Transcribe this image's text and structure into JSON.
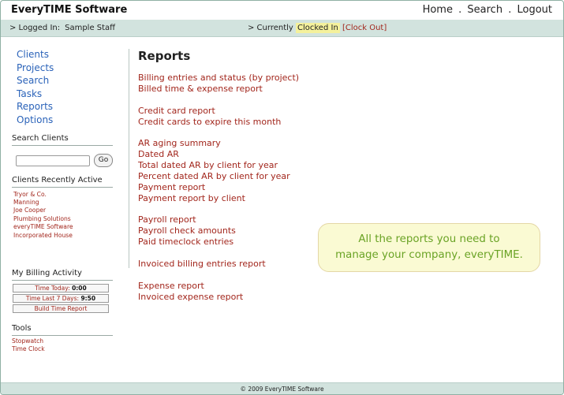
{
  "app": {
    "title": "EveryTIME Software"
  },
  "topnav": {
    "home": "Home",
    "search": "Search",
    "logout": "Logout",
    "sep": "."
  },
  "status": {
    "logged_in_label": "> Logged In:",
    "user": "Sample Staff",
    "currently_label": "> Currently",
    "state": "Clocked In",
    "clock_out": "[Clock Out]"
  },
  "sidebar": {
    "nav": [
      "Clients",
      "Projects",
      "Search",
      "Tasks",
      "Reports",
      "Options"
    ],
    "search_heading": "Search Clients",
    "search_placeholder": "",
    "go_label": "Go",
    "recent_heading": "Clients Recently Active",
    "recent": [
      "Tryor & Co.",
      "Manning",
      "Joe Cooper",
      "Plumbing Solutions",
      "everyTIME Software",
      "Incorporated House"
    ],
    "billing_heading": "My Billing Activity",
    "time_today_label": "Time Today:",
    "time_today_value": "0:00",
    "time_week_label": "Time Last 7 Days:",
    "time_week_value": "9:50",
    "build_report": "Build Time Report",
    "tools_heading": "Tools",
    "tools": [
      "Stopwatch",
      "Time Clock"
    ]
  },
  "main": {
    "title": "Reports",
    "groups": [
      [
        "Billing entries and status (by project)",
        "Billed time & expense report"
      ],
      [
        "Credit card report",
        "Credit cards to expire this month"
      ],
      [
        "AR aging summary",
        "Dated AR",
        "Total dated AR by client for year",
        "Percent dated AR by client for year",
        "Payment report",
        "Payment report by client"
      ],
      [
        "Payroll report",
        "Payroll check amounts",
        "Paid timeclock entries"
      ],
      [
        "Invoiced billing entries report"
      ],
      [
        "Expense report",
        "Invoiced expense report"
      ]
    ]
  },
  "promo": {
    "line1": "All the reports you need to",
    "line2": "manage your company, everyTIME."
  },
  "footer": {
    "text": "© 2009 EveryTIME Software"
  },
  "colors": {
    "accent_link": "#a2261c",
    "nav_link": "#2b63b9",
    "bar_bg": "#d2e3de",
    "promo_text": "#6aa325"
  }
}
